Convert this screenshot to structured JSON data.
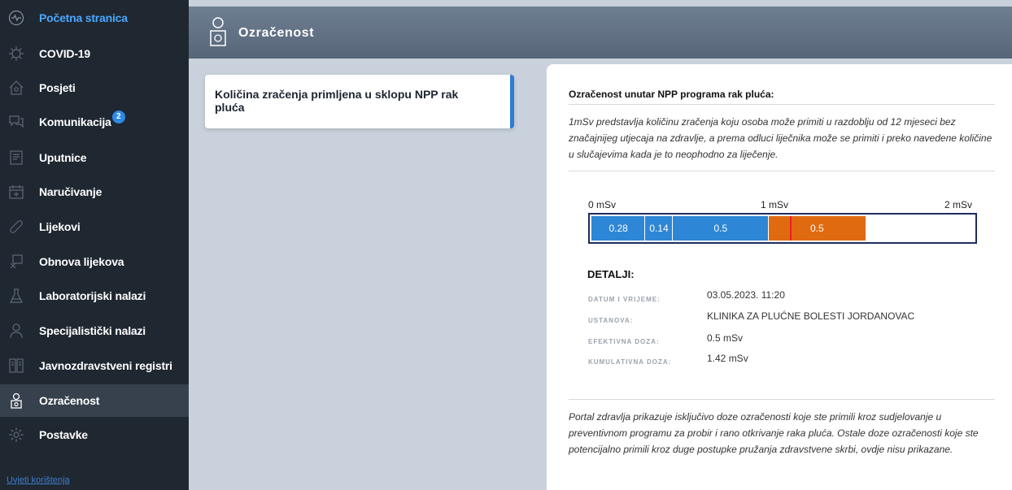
{
  "sidebar": {
    "items": [
      {
        "label": "Početna stranica",
        "icon": "pulse-icon"
      },
      {
        "label": "COVID-19",
        "icon": "virus-icon"
      },
      {
        "label": "Posjeti",
        "icon": "house-icon"
      },
      {
        "label": "Komunikacija",
        "icon": "chat-icon",
        "badge": "2"
      },
      {
        "label": "Uputnice",
        "icon": "document-icon"
      },
      {
        "label": "Naručivanje",
        "icon": "calendar-icon"
      },
      {
        "label": "Lijekovi",
        "icon": "pill-icon"
      },
      {
        "label": "Obnova lijekova",
        "icon": "prescription-icon"
      },
      {
        "label": "Laboratorijski nalazi",
        "icon": "flask-icon"
      },
      {
        "label": "Specijalistički nalazi",
        "icon": "doctor-icon"
      },
      {
        "label": "Javnozdravstveni registri",
        "icon": "registry-icon"
      },
      {
        "label": "Ozračenost",
        "icon": "radiation-person-icon"
      },
      {
        "label": "Postavke",
        "icon": "gear-icon"
      }
    ],
    "footer_link": "Uvjeti korištenja"
  },
  "header": {
    "title": "Ozračenost",
    "icon": "radiation-person-icon"
  },
  "card": {
    "title": "Količina zračenja primljena u sklopu NPP rak pluća"
  },
  "panel": {
    "title": "Ozračenost unutar NPP programa rak pluća:",
    "description": "1mSv predstavlja količinu zračenja koju osoba može primiti u razdoblju od 12 mjeseci bez značajnijeg utjecaja na zdravlje, a prema odluci liječnika može se primiti i preko navedene količine u slučajevima kada je to neophodno za liječenje.",
    "scale": {
      "min": "0 mSv",
      "mid": "1 mSv",
      "max": "2 mSv"
    },
    "dose_bar": {
      "max_value": 2,
      "threshold": 1,
      "segments": [
        {
          "label": "0.28",
          "value": 0.28,
          "color": "#2d86d6"
        },
        {
          "label": "0.14",
          "value": 0.14,
          "color": "#2d86d6"
        },
        {
          "label": "0.5",
          "value": 0.5,
          "color": "#2d86d6"
        },
        {
          "label": "0.5",
          "value": 0.5,
          "color": "#e06a10"
        }
      ]
    },
    "details": {
      "heading": "DETALJI:",
      "rows": [
        {
          "label": "DATUM I VRIJEME:",
          "value": "03.05.2023. 11:20"
        },
        {
          "label": "USTANOVA:",
          "value": "KLINIKA ZA PLUĆNE BOLESTI JORDANOVAC"
        },
        {
          "label": "EFEKTIVNA DOZA:",
          "value": "0.5 mSv"
        },
        {
          "label": "KUMULATIVNA DOZA:",
          "value": "1.42 mSv"
        }
      ]
    },
    "note": "Portal zdravlja prikazuje isključivo doze ozračenosti koje ste primili kroz sudjelovanje u preventivnom programu za probir i rano otkrivanje raka pluća. Ostale doze ozračenosti koje ste potencijalno primili kroz duge postupke pružanja zdravstvene skrbi, ovdje nisu prikazane."
  },
  "colors": {
    "sidebar_bg": "#1f2731",
    "accent_blue": "#2e7dd1",
    "dose_orange": "#e06a10",
    "threshold_red": "#e8202a"
  }
}
